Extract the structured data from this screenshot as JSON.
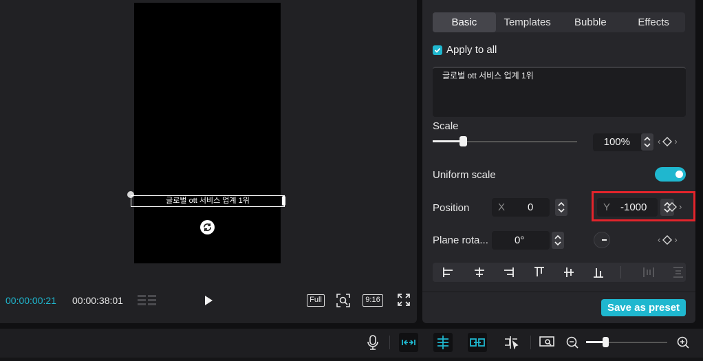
{
  "player": {
    "subtitle_overlay": "글로벌 ott 서비스 업계 1위",
    "current_time": "00:00:00:21",
    "total_time": "00:00:38:01",
    "controls": {
      "full_label": "Full",
      "ratio_label": "9:16"
    }
  },
  "panel": {
    "tabs": [
      {
        "label": "Basic",
        "active": true
      },
      {
        "label": "Templates",
        "active": false
      },
      {
        "label": "Bubble",
        "active": false
      },
      {
        "label": "Effects",
        "active": false
      }
    ],
    "apply_to_all": {
      "label": "Apply to all",
      "checked": true
    },
    "text_value": "글로벌 ott 서비스 업계 1위",
    "scale": {
      "label": "Scale",
      "value": "100%",
      "slider_fraction": 0.21
    },
    "uniform_scale": {
      "label": "Uniform scale",
      "enabled": true
    },
    "position": {
      "label": "Position",
      "x_label": "X",
      "x_value": "0",
      "y_label": "Y",
      "y_value": "-1000"
    },
    "plane_rotation": {
      "label": "Plane rota...",
      "value": "0°"
    },
    "save_preset": "Save as preset",
    "accent_color": "#1fb7cf",
    "highlight_color": "#e3242b"
  },
  "toolbar": {
    "icons": [
      "microphone-icon",
      "link-main-track-icon",
      "split-magnet-icon",
      "link-clips-icon",
      "preview-axis-icon",
      "thumbnail-zoom-icon",
      "zoom-out-icon",
      "zoom-in-icon"
    ],
    "zoom_fraction": 0.24
  }
}
